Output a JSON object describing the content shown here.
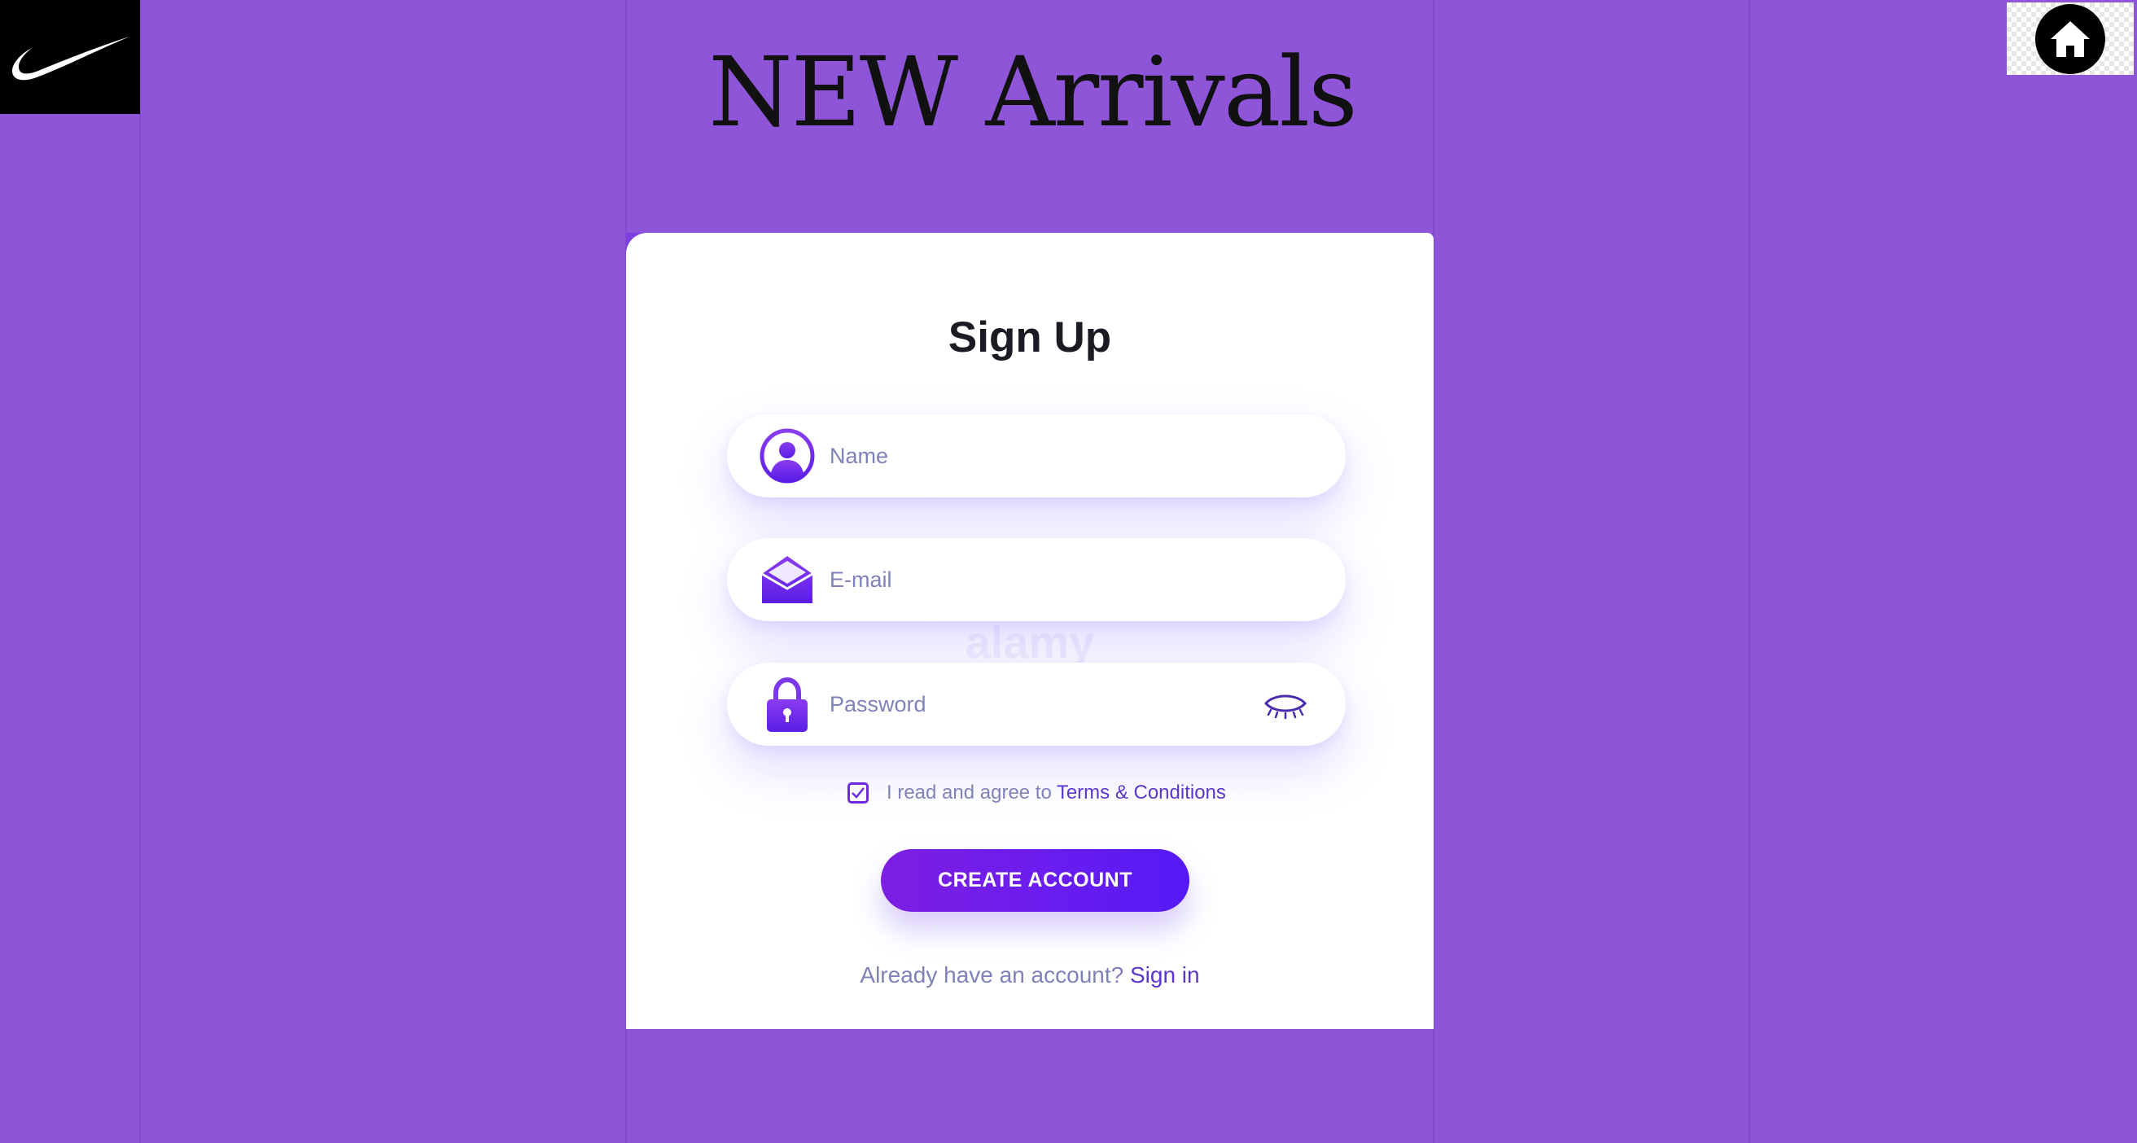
{
  "page": {
    "heading": "NEW Arrivals"
  },
  "logo": {
    "icon": "swoosh-icon"
  },
  "home_button": {
    "icon": "home-icon"
  },
  "signup": {
    "title": "Sign Up",
    "name_placeholder": "Name",
    "email_placeholder": "E-mail",
    "password_placeholder": "Password",
    "terms_prefix": "I read and agree to",
    "terms_link": "Terms & Conditions",
    "terms_checked": true,
    "create_button": "CREATE ACCOUNT",
    "signin_prompt": "Already have an account?",
    "signin_link": "Sign in",
    "watermark": "alamy"
  },
  "colors": {
    "background": "#8e55d9",
    "accent": "#6a2be0",
    "link": "#5a37c9",
    "placeholder": "#7f82b8"
  }
}
